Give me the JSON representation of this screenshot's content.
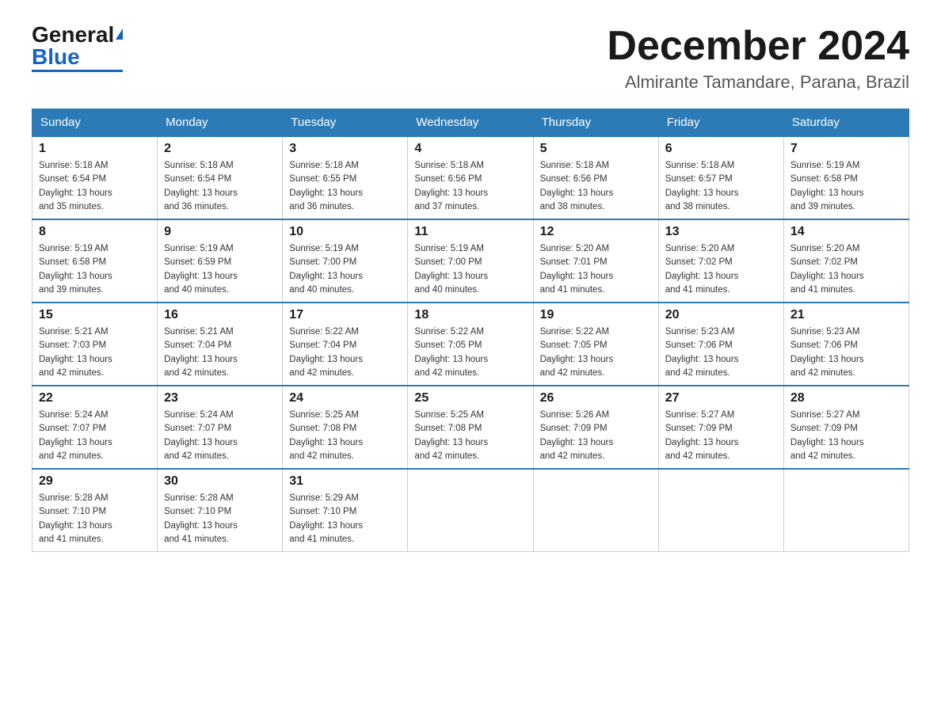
{
  "header": {
    "logo": {
      "general": "General",
      "blue": "Blue"
    },
    "title": "December 2024",
    "location": "Almirante Tamandare, Parana, Brazil"
  },
  "days_of_week": [
    "Sunday",
    "Monday",
    "Tuesday",
    "Wednesday",
    "Thursday",
    "Friday",
    "Saturday"
  ],
  "weeks": [
    [
      {
        "day": 1,
        "sunrise": "5:18 AM",
        "sunset": "6:54 PM",
        "daylight": "13 hours and 35 minutes."
      },
      {
        "day": 2,
        "sunrise": "5:18 AM",
        "sunset": "6:54 PM",
        "daylight": "13 hours and 36 minutes."
      },
      {
        "day": 3,
        "sunrise": "5:18 AM",
        "sunset": "6:55 PM",
        "daylight": "13 hours and 36 minutes."
      },
      {
        "day": 4,
        "sunrise": "5:18 AM",
        "sunset": "6:56 PM",
        "daylight": "13 hours and 37 minutes."
      },
      {
        "day": 5,
        "sunrise": "5:18 AM",
        "sunset": "6:56 PM",
        "daylight": "13 hours and 38 minutes."
      },
      {
        "day": 6,
        "sunrise": "5:18 AM",
        "sunset": "6:57 PM",
        "daylight": "13 hours and 38 minutes."
      },
      {
        "day": 7,
        "sunrise": "5:19 AM",
        "sunset": "6:58 PM",
        "daylight": "13 hours and 39 minutes."
      }
    ],
    [
      {
        "day": 8,
        "sunrise": "5:19 AM",
        "sunset": "6:58 PM",
        "daylight": "13 hours and 39 minutes."
      },
      {
        "day": 9,
        "sunrise": "5:19 AM",
        "sunset": "6:59 PM",
        "daylight": "13 hours and 40 minutes."
      },
      {
        "day": 10,
        "sunrise": "5:19 AM",
        "sunset": "7:00 PM",
        "daylight": "13 hours and 40 minutes."
      },
      {
        "day": 11,
        "sunrise": "5:19 AM",
        "sunset": "7:00 PM",
        "daylight": "13 hours and 40 minutes."
      },
      {
        "day": 12,
        "sunrise": "5:20 AM",
        "sunset": "7:01 PM",
        "daylight": "13 hours and 41 minutes."
      },
      {
        "day": 13,
        "sunrise": "5:20 AM",
        "sunset": "7:02 PM",
        "daylight": "13 hours and 41 minutes."
      },
      {
        "day": 14,
        "sunrise": "5:20 AM",
        "sunset": "7:02 PM",
        "daylight": "13 hours and 41 minutes."
      }
    ],
    [
      {
        "day": 15,
        "sunrise": "5:21 AM",
        "sunset": "7:03 PM",
        "daylight": "13 hours and 42 minutes."
      },
      {
        "day": 16,
        "sunrise": "5:21 AM",
        "sunset": "7:04 PM",
        "daylight": "13 hours and 42 minutes."
      },
      {
        "day": 17,
        "sunrise": "5:22 AM",
        "sunset": "7:04 PM",
        "daylight": "13 hours and 42 minutes."
      },
      {
        "day": 18,
        "sunrise": "5:22 AM",
        "sunset": "7:05 PM",
        "daylight": "13 hours and 42 minutes."
      },
      {
        "day": 19,
        "sunrise": "5:22 AM",
        "sunset": "7:05 PM",
        "daylight": "13 hours and 42 minutes."
      },
      {
        "day": 20,
        "sunrise": "5:23 AM",
        "sunset": "7:06 PM",
        "daylight": "13 hours and 42 minutes."
      },
      {
        "day": 21,
        "sunrise": "5:23 AM",
        "sunset": "7:06 PM",
        "daylight": "13 hours and 42 minutes."
      }
    ],
    [
      {
        "day": 22,
        "sunrise": "5:24 AM",
        "sunset": "7:07 PM",
        "daylight": "13 hours and 42 minutes."
      },
      {
        "day": 23,
        "sunrise": "5:24 AM",
        "sunset": "7:07 PM",
        "daylight": "13 hours and 42 minutes."
      },
      {
        "day": 24,
        "sunrise": "5:25 AM",
        "sunset": "7:08 PM",
        "daylight": "13 hours and 42 minutes."
      },
      {
        "day": 25,
        "sunrise": "5:25 AM",
        "sunset": "7:08 PM",
        "daylight": "13 hours and 42 minutes."
      },
      {
        "day": 26,
        "sunrise": "5:26 AM",
        "sunset": "7:09 PM",
        "daylight": "13 hours and 42 minutes."
      },
      {
        "day": 27,
        "sunrise": "5:27 AM",
        "sunset": "7:09 PM",
        "daylight": "13 hours and 42 minutes."
      },
      {
        "day": 28,
        "sunrise": "5:27 AM",
        "sunset": "7:09 PM",
        "daylight": "13 hours and 42 minutes."
      }
    ],
    [
      {
        "day": 29,
        "sunrise": "5:28 AM",
        "sunset": "7:10 PM",
        "daylight": "13 hours and 41 minutes."
      },
      {
        "day": 30,
        "sunrise": "5:28 AM",
        "sunset": "7:10 PM",
        "daylight": "13 hours and 41 minutes."
      },
      {
        "day": 31,
        "sunrise": "5:29 AM",
        "sunset": "7:10 PM",
        "daylight": "13 hours and 41 minutes."
      },
      null,
      null,
      null,
      null
    ]
  ],
  "labels": {
    "sunrise": "Sunrise:",
    "sunset": "Sunset:",
    "daylight": "Daylight:"
  }
}
